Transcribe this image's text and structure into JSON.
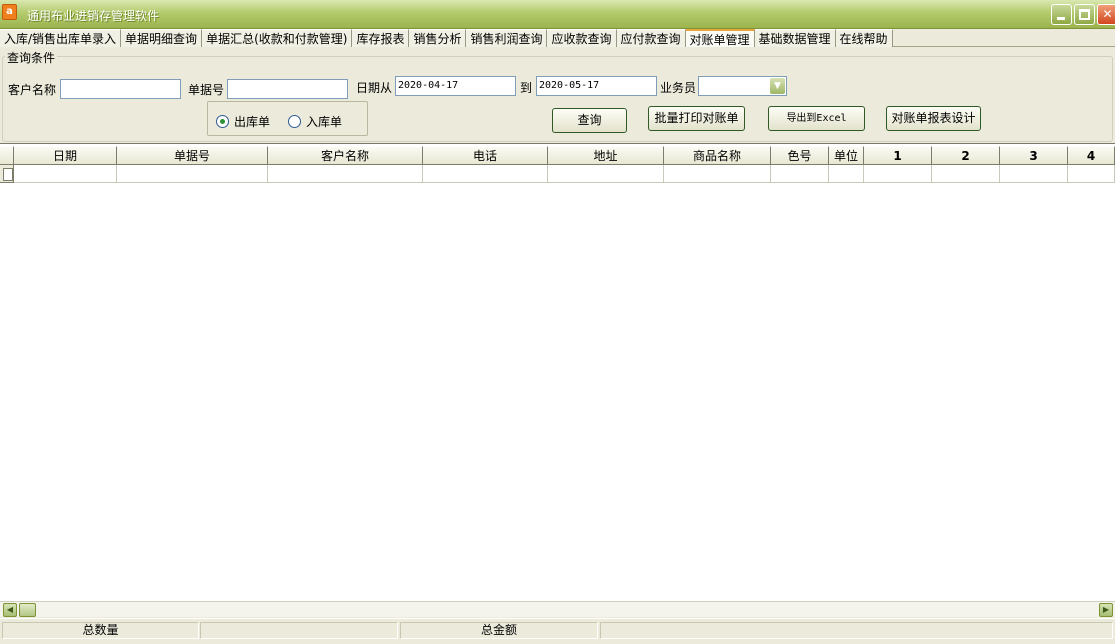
{
  "window": {
    "title": "通用布业进销存管理软件",
    "icon_letter": "a",
    "minimize": "",
    "maximize": "",
    "close": "✕"
  },
  "tabs": [
    {
      "label": "入库/销售出库单录入",
      "active": false
    },
    {
      "label": "单据明细查询",
      "active": false
    },
    {
      "label": "单据汇总(收款和付款管理)",
      "active": false
    },
    {
      "label": "库存报表",
      "active": false
    },
    {
      "label": "销售分析",
      "active": false
    },
    {
      "label": "销售利润查询",
      "active": false
    },
    {
      "label": "应收款查询",
      "active": false
    },
    {
      "label": "应付款查询",
      "active": false
    },
    {
      "label": "对账单管理",
      "active": true
    },
    {
      "label": "基础数据管理",
      "active": false
    },
    {
      "label": "在线帮助",
      "active": false
    }
  ],
  "query": {
    "group_title": "查询条件",
    "customer_label": "客户名称",
    "customer_value": "",
    "doc_no_label": "单据号",
    "doc_no_value": "",
    "date_from_label": "日期从",
    "date_from": "2020-04-17",
    "date_to_label": "到",
    "date_to": "2020-05-17",
    "salesman_label": "业务员",
    "salesman_value": "",
    "radio_outbound": "出库单",
    "radio_inbound": "入库单",
    "selected_radio": "出库单",
    "btn_query": "查询",
    "btn_batch_print": "批量打印对账单",
    "btn_export": "导出到Excel",
    "btn_design": "对账单报表设计"
  },
  "grid": {
    "columns": [
      "日期",
      "单据号",
      "客户名称",
      "电话",
      "地址",
      "商品名称",
      "色号",
      "单位",
      "1",
      "2",
      "3",
      "4"
    ],
    "rows": [
      [
        "",
        "",
        "",
        "",
        "",
        "",
        "",
        "",
        "",
        "",
        "",
        ""
      ]
    ]
  },
  "statusbar": {
    "total_qty_label": "总数量",
    "total_qty_value": "",
    "total_amount_label": "总金额",
    "total_amount_value": ""
  },
  "colors": {
    "titlebar": "#9bb44e",
    "active_tab_accent": "#e8a33d",
    "panel_bg": "#ebeadb",
    "close_button": "#d2461e"
  },
  "icons": {
    "app": "app-icon",
    "minimize": "minimize-icon",
    "maximize": "maximize-icon",
    "close": "close-icon",
    "dropdown": "chevron-down-icon",
    "scroll_left": "arrow-left-icon",
    "scroll_right": "arrow-right-icon"
  }
}
